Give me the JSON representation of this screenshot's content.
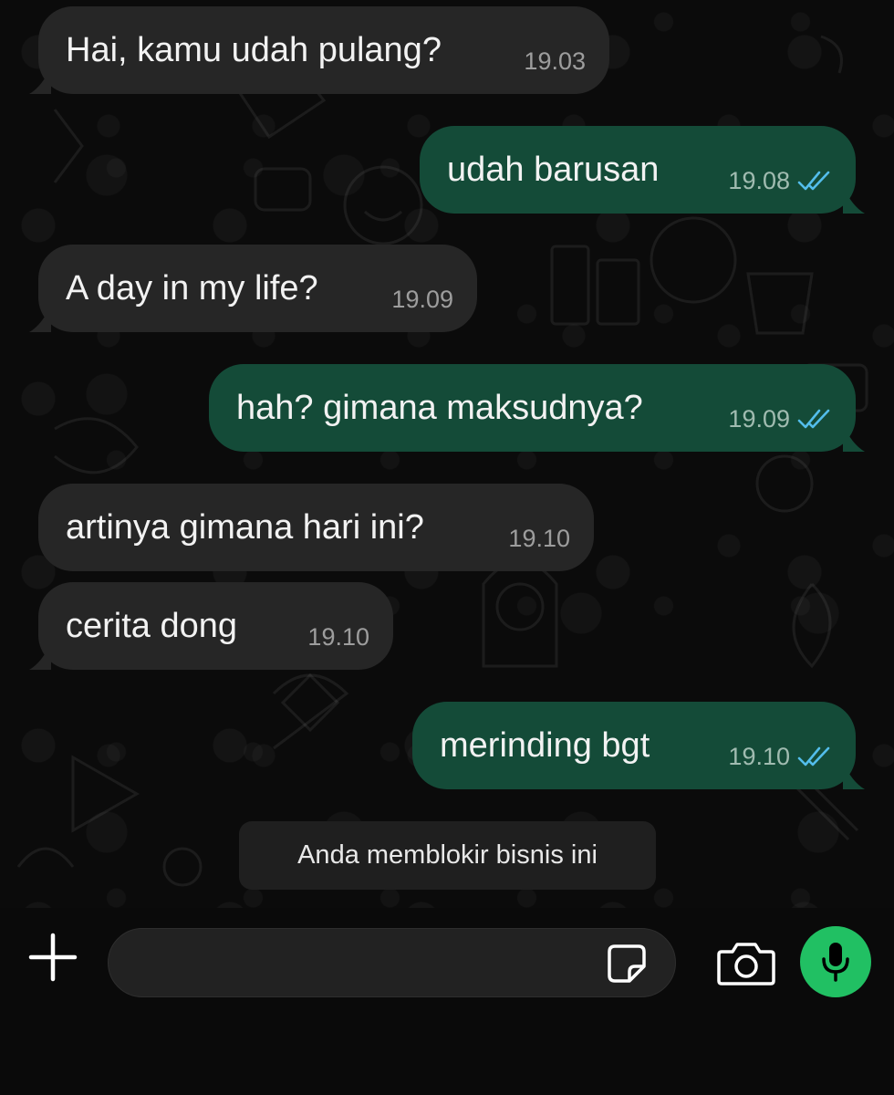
{
  "messages": [
    {
      "direction": "in",
      "text": "Hai, kamu udah pulang?",
      "time": "19.03",
      "tail": true
    },
    {
      "direction": "out",
      "text": "udah barusan",
      "time": "19.08",
      "status": "read",
      "tail": true
    },
    {
      "direction": "in",
      "text": "A day in my life?",
      "time": "19.09",
      "tail": true
    },
    {
      "direction": "out",
      "text": "hah? gimana maksudnya?",
      "time": "19.09",
      "status": "read",
      "tail": true
    },
    {
      "direction": "in",
      "text": "artinya gimana hari ini?",
      "time": "19.10",
      "tail": false
    },
    {
      "direction": "in",
      "text": "cerita dong",
      "time": "19.10",
      "tail": true
    },
    {
      "direction": "out",
      "text": "merinding bgt",
      "time": "19.10",
      "status": "read",
      "tail": true
    }
  ],
  "system_notice": "Anda memblokir bisnis ini",
  "composer": {
    "plus_icon": "plus-icon",
    "input_value": "",
    "sticker_icon": "sticker-icon",
    "camera_icon": "camera-icon",
    "mic_icon": "microphone-icon"
  },
  "colors": {
    "incoming_bubble": "#262626",
    "outgoing_bubble": "#144b38",
    "read_ticks": "#53bdeb",
    "mic_button": "#21c063",
    "chat_background": "#0b0b0b"
  }
}
